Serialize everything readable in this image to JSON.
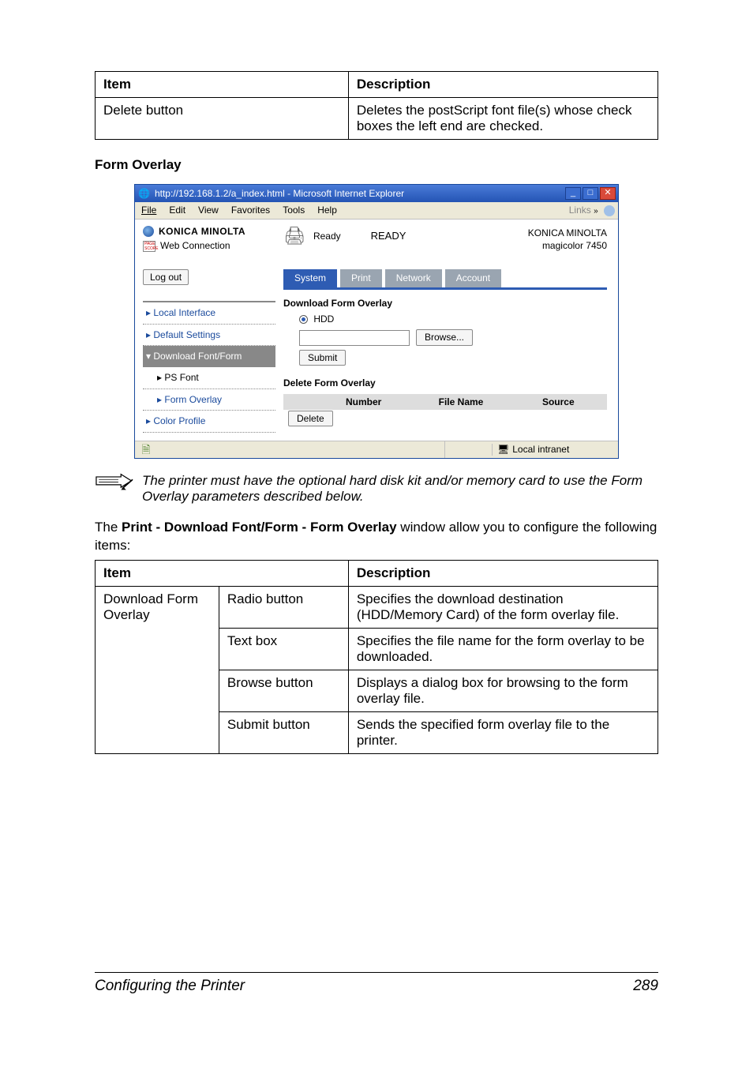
{
  "top_table": {
    "head_item": "Item",
    "head_desc": "Description",
    "row1_item": "Delete button",
    "row1_desc": "Deletes the postScript font file(s) whose check boxes the left end are checked."
  },
  "section_heading": "Form Overlay",
  "screenshot": {
    "title": "http://192.168.1.2/a_index.html - Microsoft Internet Explorer",
    "menu": {
      "file": "File",
      "edit": "Edit",
      "view": "View",
      "favorites": "Favorites",
      "tools": "Tools",
      "help": "Help",
      "links": "Links"
    },
    "brand": "KONICA MINOLTA",
    "webconn": "Web Connection",
    "logout": "Log out",
    "nav": {
      "local": "Local Interface",
      "defaults": "Default Settings",
      "dlff": "Download Font/Form",
      "psfont": "PS Font",
      "formoverlay": "Form Overlay",
      "colorprofile": "Color Profile"
    },
    "ready_label": "Ready",
    "ready_status": "READY",
    "model_line1": "KONICA MINOLTA",
    "model_line2": "magicolor 7450",
    "tabs": {
      "system": "System",
      "print": "Print",
      "network": "Network",
      "account": "Account"
    },
    "dl_heading": "Download Form Overlay",
    "radio_hdd": "HDD",
    "browse": "Browse...",
    "submit": "Submit",
    "del_heading": "Delete Form Overlay",
    "del_cols": {
      "number": "Number",
      "filename": "File Name",
      "source": "Source"
    },
    "delete_btn": "Delete",
    "statusbar_zone": "Local intranet"
  },
  "note": "The printer must have the optional hard disk kit and/or memory card to use the Form Overlay parameters described below.",
  "bodytext_pre": "The ",
  "bodytext_bold": "Print - Download Font/Form - Form Overlay",
  "bodytext_post": " window allow you to configure the following items:",
  "main_table": {
    "head_item": "Item",
    "head_desc": "Description",
    "group_label": "Download Form Overlay",
    "rows": [
      {
        "sub": "Radio button",
        "desc": "Specifies the download destination (HDD/Memory Card) of the form overlay file."
      },
      {
        "sub": "Text box",
        "desc": "Specifies the file name for the form overlay to be downloaded."
      },
      {
        "sub": "Browse button",
        "desc": "Displays a dialog box for browsing to the form overlay file."
      },
      {
        "sub": "Submit button",
        "desc": "Sends the specified form overlay file to the printer."
      }
    ]
  },
  "footer": {
    "title": "Configuring the Printer",
    "page": "289"
  }
}
